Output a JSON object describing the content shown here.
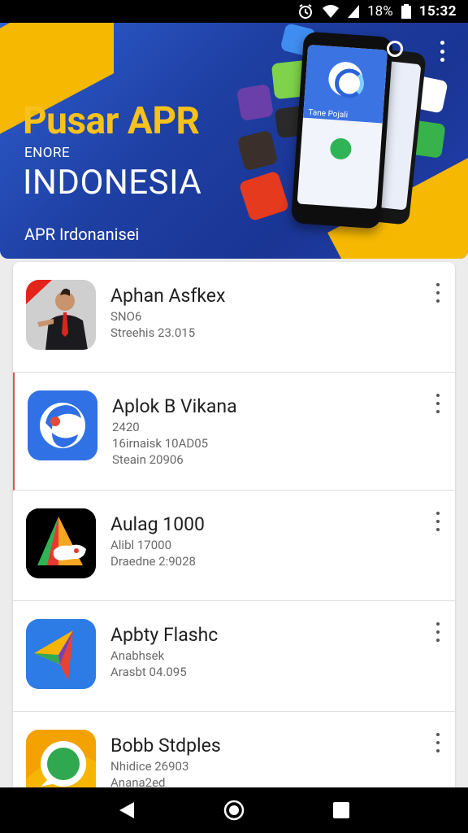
{
  "status_bar": {
    "battery_text": "18%",
    "time": "15:32",
    "icons": [
      "alarm-icon",
      "wifi-icon",
      "signal-icon",
      "battery-icon"
    ]
  },
  "banner": {
    "title": "Pusar APR",
    "small_label": "ENORE",
    "country": "INDONESIA",
    "subtitle": "APR Irdonanisei",
    "phone_text": "Tane Pojali",
    "colors": {
      "background": "#2548b8",
      "accent": "#f7c21b"
    }
  },
  "apps": [
    {
      "name": "Aphan Asfkex",
      "line1": "SNO6",
      "line2": "Streehis 23.015",
      "line3": "",
      "icon": "presenter-photo-icon"
    },
    {
      "name": "Aplok B Vikana",
      "line1": "2420",
      "line2": "16irnaisk 10AD05",
      "line3": "Steain 20906",
      "icon": "blue-swirl-logo-icon"
    },
    {
      "name": "Aulag 1000",
      "line1": "Alibl 17000",
      "line2": "Draedne 2:9028",
      "line3": "",
      "icon": "triangle-map-logo-icon"
    },
    {
      "name": "Apbty Flashc",
      "line1": "Anabhsek",
      "line2": "Arasbt 04.095",
      "line3": "",
      "icon": "paper-plane-logo-icon"
    },
    {
      "name": "Bobb Stdples",
      "line1": "Nhidice 26903",
      "line2": "Anana2ed",
      "line3": "",
      "icon": "green-circle-logo-icon"
    }
  ],
  "nav": [
    "back-icon",
    "home-icon",
    "recents-icon"
  ]
}
